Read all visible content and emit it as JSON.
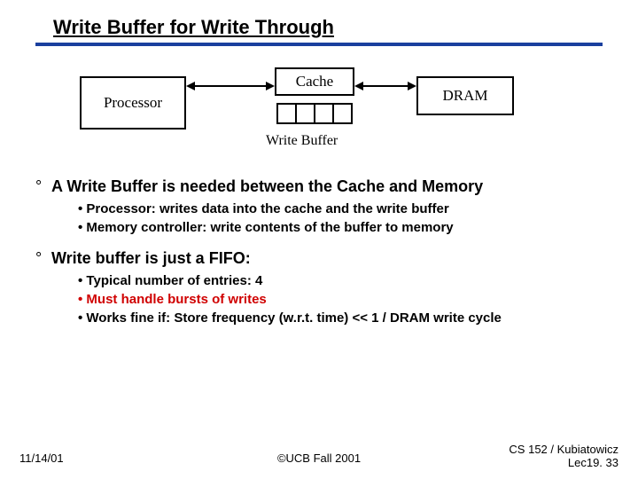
{
  "title": "Write Buffer for Write Through",
  "diagram": {
    "processor": "Processor",
    "cache": "Cache",
    "dram": "DRAM",
    "write_buffer_label": "Write Buffer"
  },
  "bullets": [
    {
      "head": "A Write Buffer is needed between the Cache and Memory",
      "subs": [
        {
          "text": "Processor: writes data into the cache and the write buffer",
          "red": false
        },
        {
          "text": "Memory controller: write contents of the buffer to memory",
          "red": false
        }
      ]
    },
    {
      "head": "Write buffer is just a FIFO:",
      "subs": [
        {
          "text": "Typical number of entries: 4",
          "red": false
        },
        {
          "text": "Must handle bursts of writes",
          "red": true
        },
        {
          "text": "Works fine if:  Store frequency (w.r.t. time) << 1 / DRAM write cycle",
          "red": false
        }
      ]
    }
  ],
  "footer": {
    "date": "11/14/01",
    "center": "©UCB Fall 2001",
    "right1": "CS 152 / Kubiatowicz",
    "right2": "Lec19. 33"
  }
}
